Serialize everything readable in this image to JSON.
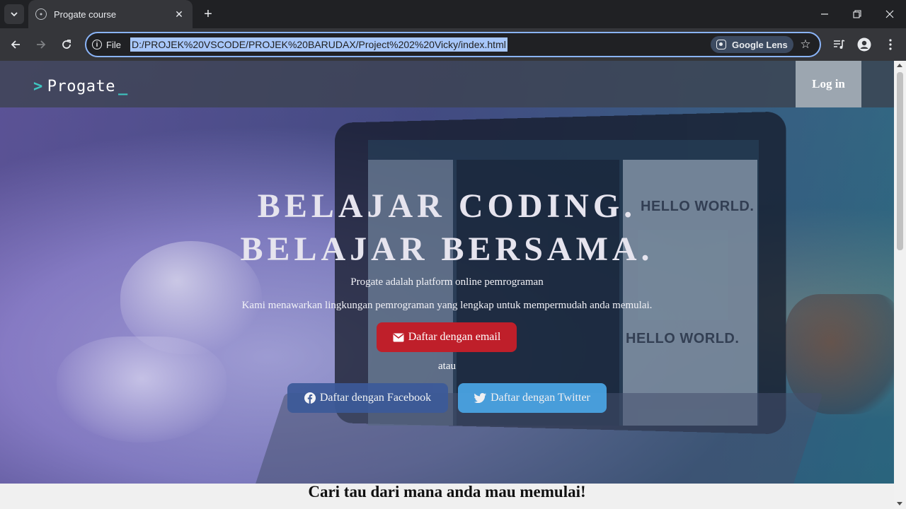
{
  "browser": {
    "tab": {
      "title": "Progate course"
    },
    "address_bar": {
      "scheme_label": "File",
      "url": "D:/PROJEK%20VSCODE/PROJEK%20BARUDAX/Project%202%20Vicky/index.html",
      "lens_label": "Google Lens"
    }
  },
  "page": {
    "header": {
      "logo": {
        "chevron": ">",
        "text": "Progate",
        "cursor": "_"
      },
      "login_label": "Log in"
    },
    "hero": {
      "headline_line1": "BELAJAR CODING.",
      "headline_line2": "BELAJAR BERSAMA.",
      "description_line1": "Progate adalah platform online pemrograman",
      "description_line2": "Kami menawarkan lingkungan pemrograman yang lengkap untuk mempermudah anda memulai.",
      "email_button": "Daftar dengan email",
      "separator": "atau",
      "facebook_button": "Daftar dengan Facebook",
      "twitter_button": "Daftar dengan Twitter",
      "background_screen_text_1": "HELLO WORLD.",
      "background_screen_text_2": "HELLO WORLD."
    },
    "section_title": "Cari tau dari mana anda mau memulai!"
  },
  "colors": {
    "brand_accent": "#3ec6c0",
    "email_button": "#bf1f2a",
    "facebook_button": "#3c5a99",
    "twitter_button": "#4aa6e6",
    "omnibox_focus": "#8ab4f8"
  },
  "icons": {
    "tab_search": "chevron-down-icon",
    "favicon": "globe-icon",
    "close": "close-icon",
    "new_tab": "plus-icon",
    "back": "arrow-left-icon",
    "forward": "arrow-right-icon",
    "reload": "reload-icon",
    "info": "info-icon",
    "lens": "lens-icon",
    "bookmark": "star-icon",
    "media": "media-control-icon",
    "profile": "profile-icon",
    "menu": "kebab-menu-icon",
    "email": "envelope-icon",
    "facebook": "facebook-icon",
    "twitter": "twitter-icon"
  }
}
